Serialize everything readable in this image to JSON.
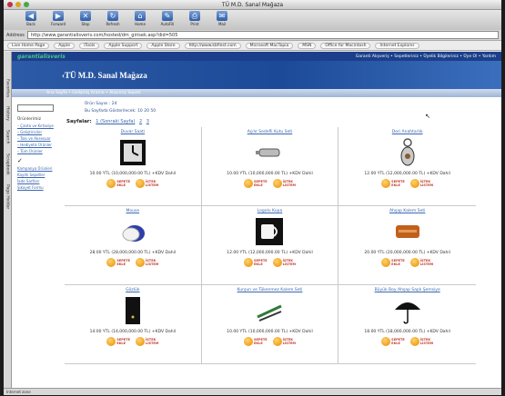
{
  "window": {
    "title": "TÜ M.D. Sanal Mağaza"
  },
  "toolbar": [
    {
      "label": "Back",
      "icon": "back-arrow-icon",
      "glyph": "◀"
    },
    {
      "label": "Forward",
      "icon": "forward-arrow-icon",
      "glyph": "▶"
    },
    {
      "label": "Stop",
      "icon": "stop-icon",
      "glyph": "✕"
    },
    {
      "label": "Refresh",
      "icon": "refresh-icon",
      "glyph": "↻"
    },
    {
      "label": "Home",
      "icon": "home-icon",
      "glyph": "⌂"
    },
    {
      "label": "AutoFill",
      "icon": "autofill-icon",
      "glyph": "✎"
    },
    {
      "label": "Print",
      "icon": "print-icon",
      "glyph": "⎙"
    },
    {
      "label": "Mail",
      "icon": "mail-icon",
      "glyph": "✉"
    }
  ],
  "address": {
    "label": "Address",
    "url": "http://www.garantialisveris.com/hosted/dm_girisek.asp?did=505"
  },
  "favorites": [
    "Live Home Page",
    "Apple",
    "iTools",
    "Apple Support",
    "Apple Store",
    "http://www.kbfiest.com",
    "Microsoft MacTopia",
    "MSN",
    "Office for Macintosh",
    "Internet Explorer"
  ],
  "sidetabs": [
    "Favorites",
    "History",
    "Search",
    "Scrapbook",
    "Page Holder"
  ],
  "site": {
    "brand": "garantialisveris",
    "toplinks": "Garanti Alışveriş • Sepetleriniz • Üyelik Bilgileriniz • Üye Ol • Yardım",
    "hero_title": "‹TÜ M.D. Sanal Mağaza",
    "crumbs": "Ana Sayfa  •  Gelişmiş Arama  •  Alışveriş Sepeti",
    "left": {
      "heading": "Ürünlerimiz",
      "links": [
        "Çanta ve Kırtasiye",
        "Geliştiriciler",
        "Takı ve Aksesuar",
        "Hediyelik Ürünler",
        "Tüm Ürünler"
      ],
      "marker": "✓",
      "extra_links": [
        "Kampanya Ürünleri",
        "Kayıtlı Sepetler",
        "İade Sartları",
        "Şikayet Formu"
      ]
    },
    "info_lines": [
      "Ürün Sayısı : 24",
      "Bu Sayfada Gösterilecek: 10  20  50"
    ],
    "pages_label": "Sayfalar:",
    "pages_links": [
      "1 (Sonraki Sayfa)",
      "2",
      "3"
    ],
    "add_label_1": "SEPETE",
    "add_label_2": "EKLE",
    "wish_label_1": "İSTEK",
    "wish_label_2": "LİSTEM"
  },
  "products": [
    {
      "name": "Duvar Saati",
      "price": "10.00 YTL (10,000,000.00 TL)  +KDV Dahil",
      "icon": "wall-clock-icon"
    },
    {
      "name": "Açılır Sedefli Kutu Seti",
      "price": "10.00 YTL (10,000,000.00 TL)  +KDV Dahil",
      "icon": "usb-drive-icon"
    },
    {
      "name": "Deri Anahtarlık",
      "price": "12.00 YTL (12,000,000.00 TL)  +KDV Dahil",
      "icon": "keychain-icon"
    },
    {
      "name": "Mouse",
      "price": "28.00 YTL (28,000,000.00 TL)  +KDV Dahil",
      "icon": "mouse-icon"
    },
    {
      "name": "Logolu Kupa",
      "price": "12.00 YTL (12,000,000.00 TL)  +KDV Dahil",
      "icon": "mug-icon"
    },
    {
      "name": "Ahşap Kalem Seti",
      "price": "20.00 YTL (20,000,000.00 TL)  +KDV Dahil",
      "icon": "pen-case-icon"
    },
    {
      "name": "Gözlük",
      "price": "14.00 YTL (14,000,000.00 TL)  +KDV Dahil",
      "icon": "notebook-icon"
    },
    {
      "name": "Kurşun ve Tükenmez Kalem Seti",
      "price": "10.00 YTL (10,000,000.00 TL)  +KDV Dahil",
      "icon": "pen-set-icon"
    },
    {
      "name": "Büyük Boy Ahşap Saplı Şemsiye",
      "price": "18.00 YTL (18,000,000.00 TL)  +KDV Dahil",
      "icon": "umbrella-icon"
    }
  ],
  "status": "Internet zone"
}
